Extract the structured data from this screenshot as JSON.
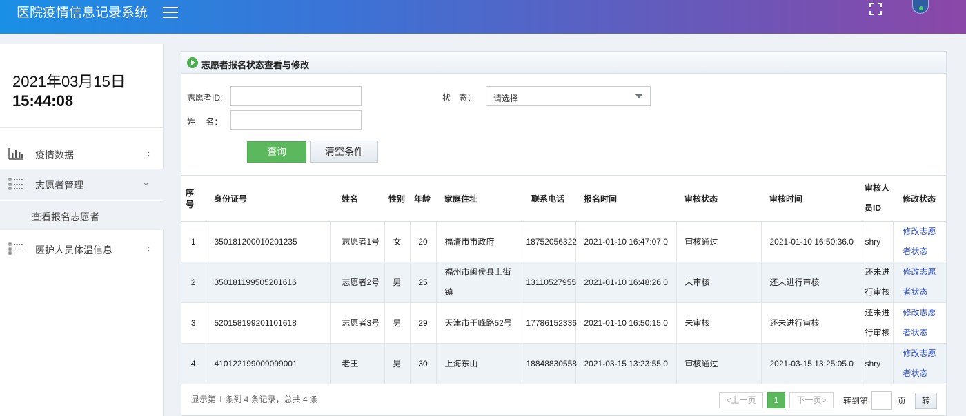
{
  "header": {
    "title": "医院疫情信息记录系统"
  },
  "clock": {
    "date": "2021年03月15日",
    "time": "15:44:08"
  },
  "sidebar": {
    "items": [
      {
        "label": "疫情数据",
        "icon": "bar-chart-icon",
        "chevron": "‹"
      },
      {
        "label": "志愿者管理",
        "icon": "list-icon",
        "chevron": "⌄"
      },
      {
        "label": "医护人员体温信息",
        "icon": "list-icon",
        "chevron": "‹"
      }
    ],
    "sub_item": "查看报名志愿者"
  },
  "panel": {
    "title": "志愿者报名状态查看与修改"
  },
  "form": {
    "id_label": "志愿者ID:",
    "name_label": "姓　 名：",
    "status_label": "状　态：",
    "status_value": "请选择",
    "query_button": "查询",
    "clear_button": "清空条件"
  },
  "table": {
    "headers": [
      "序号",
      "身份证号",
      "姓名",
      "性别",
      "年龄",
      "家庭住址",
      "联系电话",
      "报名时间",
      "审核状态",
      "审核时间",
      "审核人员ID",
      "修改状态"
    ],
    "rows": [
      [
        "1",
        "350181200010201235",
        "志愿者1号",
        "女",
        "20",
        "福清市市政府",
        "18752056322",
        "2021-01-10 16:47:07.0",
        "审核通过",
        "2021-01-10 16:50:36.0",
        "shry",
        "修改志愿者状态"
      ],
      [
        "2",
        "350181199505201616",
        "志愿者2号",
        "男",
        "25",
        "福州市闽侯县上街镇",
        "13110527955",
        "2021-01-10 16:48:26.0",
        "未审核",
        "还未进行审核",
        "还未进行审核",
        "修改志愿者状态"
      ],
      [
        "3",
        "520158199201101618",
        "志愿者3号",
        "男",
        "29",
        "天津市于峰路52号",
        "17786152336",
        "2021-01-10 16:50:15.0",
        "未审核",
        "还未进行审核",
        "还未进行审核",
        "修改志愿者状态"
      ],
      [
        "4",
        "410122199009099001",
        "老王",
        "男",
        "30",
        "上海东山",
        "18848830558",
        "2021-03-15 13:23:55.0",
        "审核通过",
        "2021-03-15 13:25:05.0",
        "shry",
        "修改志愿者状态"
      ]
    ]
  },
  "pagination": {
    "info": "显示第 1 条到 4 条记录，总共 4 条",
    "prev": "<上一页",
    "current": "1",
    "next": "下一页>",
    "goto_label": "转到第",
    "page_unit": "页",
    "go_button": "转"
  }
}
